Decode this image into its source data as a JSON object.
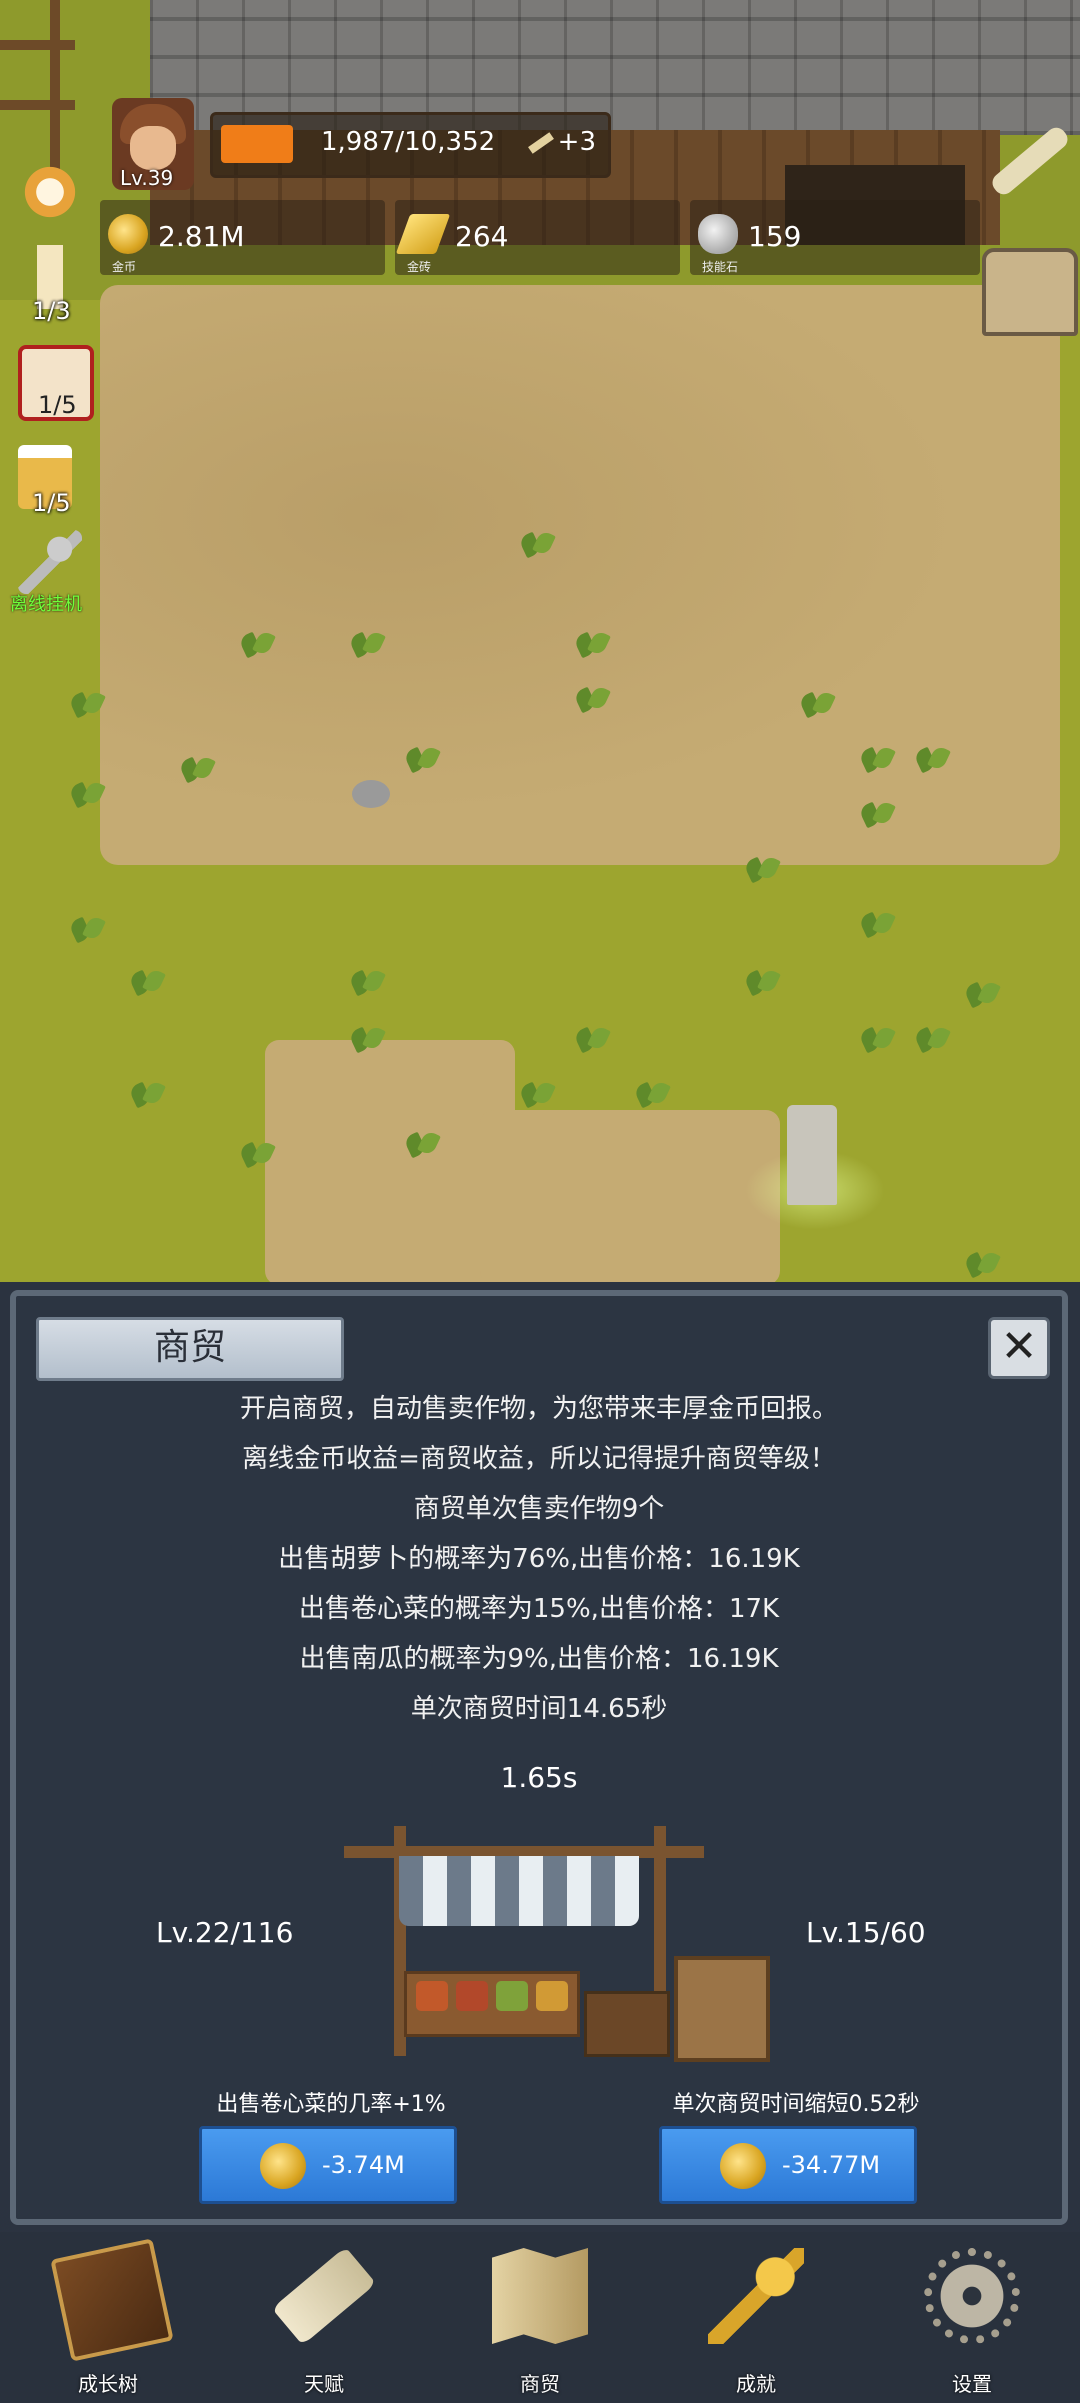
{
  "hud": {
    "level": "Lv.39",
    "xp": "1,987/10,352",
    "xp_fraction": 0.19,
    "xp_bonus": "+3",
    "resources": [
      {
        "icon": "gold-coin-icon",
        "value": "2.81M",
        "label": "金币"
      },
      {
        "icon": "gold-bar-icon",
        "value": "264",
        "label": "金砖"
      },
      {
        "icon": "skill-stone-icon",
        "value": "159",
        "label": "技能石"
      }
    ]
  },
  "side_items": [
    {
      "icon": "cake-icon",
      "count": ""
    },
    {
      "icon": "candle-icon",
      "count": "1/3"
    },
    {
      "icon": "dice-icon",
      "count": "1/5"
    },
    {
      "icon": "beer-icon",
      "count": "1/5"
    },
    {
      "icon": "idle-key-icon",
      "label": "离线挂机"
    }
  ],
  "panel": {
    "title": "商贸",
    "lines": [
      "开启商贸，自动售卖作物，为您带来丰厚金币回报。",
      "离线金币收益=商贸收益，所以记得提升商贸等级！",
      "商贸单次售卖作物9个",
      "出售胡萝卜的概率为76%,出售价格：16.19K",
      "出售卷心菜的概率为15%,出售价格：17K",
      "出售南瓜的概率为9%,出售价格：16.19K",
      "单次商贸时间14.65秒"
    ],
    "timer": "1.65s",
    "left_level": "Lv.22/116",
    "right_level": "Lv.15/60",
    "left_upgrade": {
      "label": "出售卷心菜的几率+1%",
      "cost": "-3.74M"
    },
    "right_upgrade": {
      "label": "单次商贸时间缩短0.52秒",
      "cost": "-34.77M"
    }
  },
  "nav": [
    {
      "icon": "book-icon",
      "label": "成长树"
    },
    {
      "icon": "scroll-icon",
      "label": "天赋"
    },
    {
      "icon": "map-icon",
      "label": "商贸"
    },
    {
      "icon": "key-icon",
      "label": "成就"
    },
    {
      "icon": "gear-icon",
      "label": "设置"
    }
  ]
}
